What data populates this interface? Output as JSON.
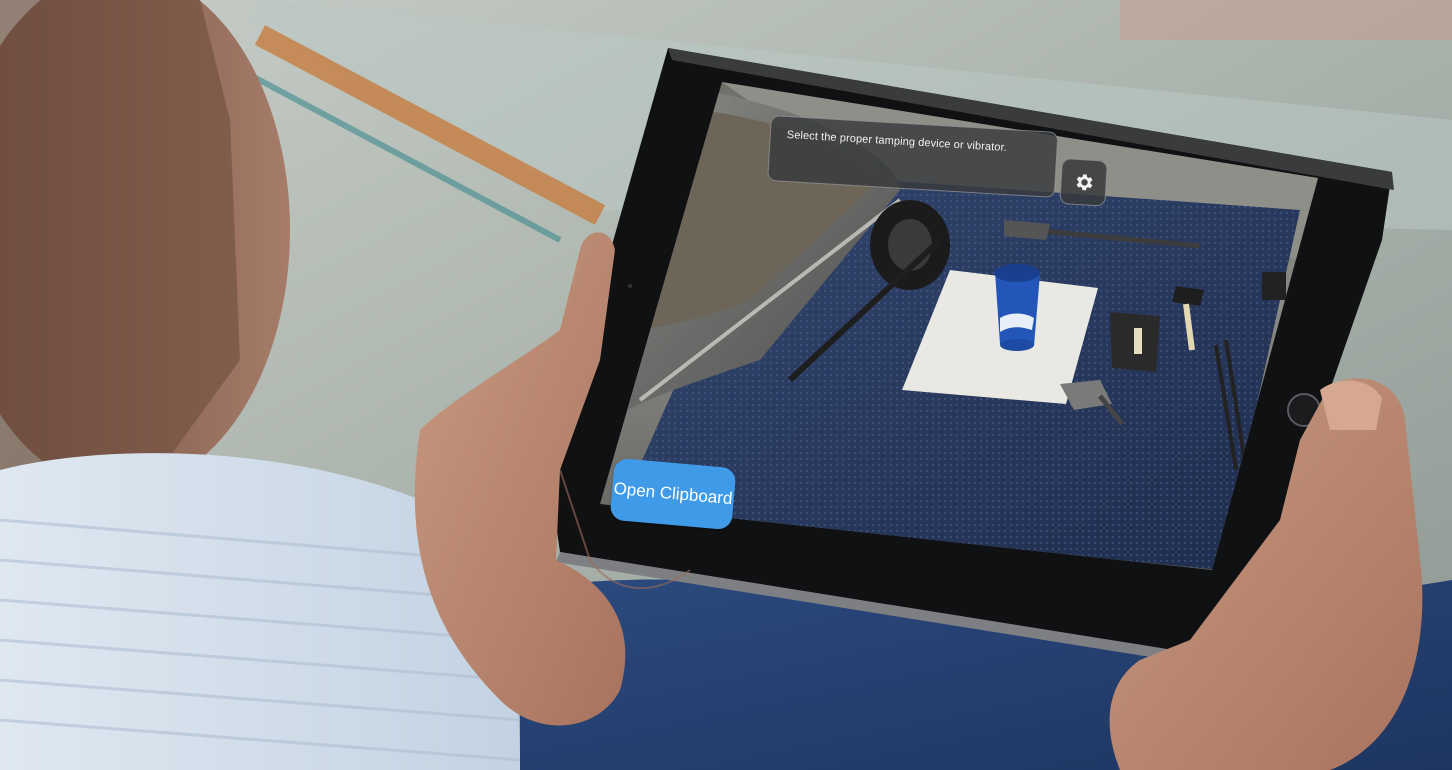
{
  "app": {
    "instruction_text": "Select the proper tamping device or vibrator.",
    "settings_icon": "gear-icon",
    "clipboard_button_label": "Open Clipboard"
  },
  "colors": {
    "button_blue": "#3f9be8",
    "panel_dark": "#37393c",
    "tarp_blue": "#2b3b63"
  }
}
